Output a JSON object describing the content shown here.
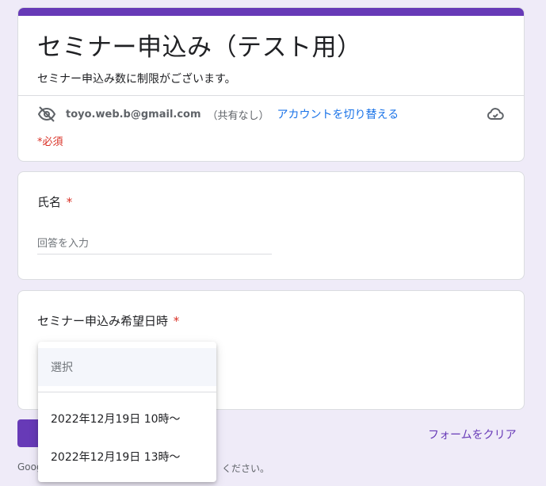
{
  "form": {
    "title": "セミナー申込み（テスト用）",
    "description": "セミナー申込み数に制限がございます。",
    "account_email": "toyo.web.b@gmail.com",
    "share_status": "（共有なし）",
    "switch_account_label": "アカウントを切り替える",
    "required_note": "*必須",
    "accent_color": "#673ab7"
  },
  "questions": {
    "name": {
      "title": "氏名",
      "required_mark": "*",
      "placeholder": "回答を入力"
    },
    "date": {
      "title": "セミナー申込み希望日時",
      "required_mark": "*"
    }
  },
  "dropdown": {
    "placeholder": "選択",
    "options": [
      "2022年12月19日 10時～",
      "2022年12月19日 13時～"
    ]
  },
  "actions": {
    "clear_label": "フォームをクリア"
  },
  "footer": {
    "left_fragment": "Goog",
    "right_fragment": "ください。"
  },
  "icons": {
    "account_visibility": "eye-off-icon",
    "save_status": "cloud-check-icon"
  }
}
